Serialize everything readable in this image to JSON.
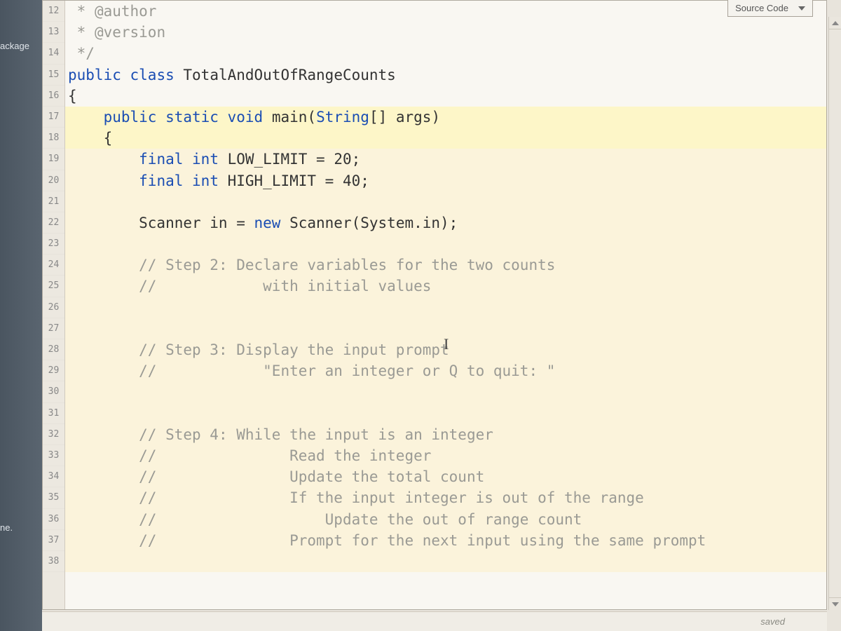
{
  "dropdown": {
    "label": "Source Code"
  },
  "leftEdge": {
    "top": "ackage",
    "bottom": "ne."
  },
  "status": {
    "text": "saved"
  },
  "gutter": [
    "12",
    "13",
    "14",
    "15",
    "16",
    "17",
    "18",
    "19",
    "20",
    "21",
    "22",
    "23",
    "24",
    "25",
    "26",
    "27",
    "28",
    "29",
    "30",
    "31",
    "32",
    "33",
    "34",
    "35",
    "36",
    "37",
    "38"
  ],
  "lines": [
    {
      "hl": "",
      "html": "<span class='tok-comment'> * </span><span class='tok-annot'>@author</span>"
    },
    {
      "hl": "",
      "html": "<span class='tok-comment'> * </span><span class='tok-annot'>@version</span>"
    },
    {
      "hl": "",
      "html": "<span class='tok-comment'> */</span>"
    },
    {
      "hl": "",
      "html": "<span class='tok-keyword'>public</span> <span class='tok-keyword'>class</span> <span class='tok-class'>TotalAndOutOfRangeCounts</span>"
    },
    {
      "hl": "",
      "html": "<span class='tok-punc'>{</span>"
    },
    {
      "hl": "hl-yellow",
      "html": "    <span class='tok-keyword'>public</span> <span class='tok-keyword'>static</span> <span class='tok-keyword'>void</span> <span class='tok-class'>main</span>(<span class='tok-type'>String</span>[] args)"
    },
    {
      "hl": "hl-yellow",
      "html": "    <span class='tok-punc'>{</span>"
    },
    {
      "hl": "hl-cream",
      "html": "        <span class='tok-keyword'>final</span> <span class='tok-keyword'>int</span> LOW_LIMIT = <span class='tok-num'>20</span>;"
    },
    {
      "hl": "hl-cream",
      "html": "        <span class='tok-keyword'>final</span> <span class='tok-keyword'>int</span> HIGH_LIMIT = <span class='tok-num'>40</span>;"
    },
    {
      "hl": "hl-cream",
      "html": ""
    },
    {
      "hl": "hl-cream",
      "html": "        Scanner in = <span class='tok-keyword'>new</span> Scanner(System.in);"
    },
    {
      "hl": "hl-cream",
      "html": ""
    },
    {
      "hl": "hl-cream",
      "html": "        <span class='tok-comment'>// Step 2: Declare variables for the two counts</span>"
    },
    {
      "hl": "hl-cream",
      "html": "        <span class='tok-comment'>//            with initial values</span>"
    },
    {
      "hl": "hl-cream",
      "html": ""
    },
    {
      "hl": "hl-cream",
      "html": ""
    },
    {
      "hl": "hl-cream",
      "html": "        <span class='tok-comment'>// Step 3: Display the input prompt</span>"
    },
    {
      "hl": "hl-cream",
      "html": "        <span class='tok-comment'>//            \"Enter an integer or Q to quit: \"</span>"
    },
    {
      "hl": "hl-cream",
      "html": ""
    },
    {
      "hl": "hl-cream",
      "html": ""
    },
    {
      "hl": "hl-cream",
      "html": "        <span class='tok-comment'>// Step 4: While the input is an integer</span>"
    },
    {
      "hl": "hl-cream",
      "html": "        <span class='tok-comment'>//               Read the integer</span>"
    },
    {
      "hl": "hl-cream",
      "html": "        <span class='tok-comment'>//               Update the total count</span>"
    },
    {
      "hl": "hl-cream",
      "html": "        <span class='tok-comment'>//               If the input integer is out of the range</span>"
    },
    {
      "hl": "hl-cream",
      "html": "        <span class='tok-comment'>//                   Update the out of range count</span>"
    },
    {
      "hl": "hl-cream",
      "html": "        <span class='tok-comment'>//               Prompt for the next input using the same prompt</span>"
    },
    {
      "hl": "hl-cream",
      "html": ""
    }
  ]
}
